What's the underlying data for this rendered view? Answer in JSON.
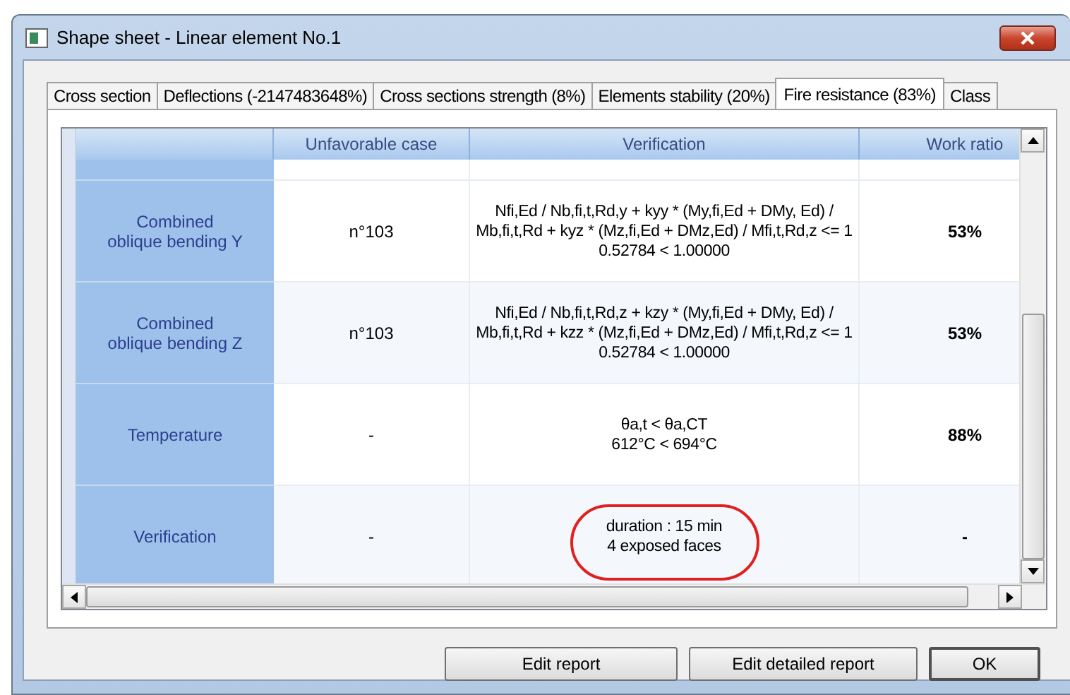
{
  "window": {
    "title": "Shape sheet - Linear element No.1"
  },
  "tabs": [
    {
      "label": "Cross section",
      "selected": false
    },
    {
      "label": "Deflections (-2147483648%)",
      "selected": false
    },
    {
      "label": "Cross sections strength (8%)",
      "selected": false
    },
    {
      "label": "Elements stability (20%)",
      "selected": false
    },
    {
      "label": "Fire resistance (83%)",
      "selected": true
    },
    {
      "label": "Class",
      "selected": false
    }
  ],
  "table": {
    "columns": [
      "Unfavorable case",
      "Verification",
      "Work ratio"
    ],
    "rows": [
      {
        "label": "Combined\noblique bending Y",
        "case": "n°103",
        "verification": "Nfi,Ed / Nb,fi,t,Rd,y + kyy * (My,fi,Ed + DMy, Ed) /\nMb,fi,t,Rd + kyz * (Mz,fi,Ed + DMz,Ed) / Mfi,t,Rd,z <= 1\n0.52784 < 1.00000",
        "ratio": "53%",
        "highlighted": false
      },
      {
        "label": "Combined\noblique bending Z",
        "case": "n°103",
        "verification": "Nfi,Ed / Nb,fi,t,Rd,z + kzy * (My,fi,Ed + DMy, Ed) /\nMb,fi,t,Rd + kzz * (Mz,fi,Ed + DMz,Ed) / Mfi,t,Rd,z <= 1\n0.52784 < 1.00000",
        "ratio": "53%",
        "highlighted": false
      },
      {
        "label": "Temperature",
        "case": "-",
        "verification": "θa,t < θa,CT\n612°C < 694°C",
        "ratio": "88%",
        "highlighted": false
      },
      {
        "label": "Verification",
        "case": "-",
        "verification": "duration : 15 min\n4 exposed faces",
        "ratio": "-",
        "highlighted": true
      }
    ]
  },
  "buttons": [
    "Edit report",
    "Edit detailed report",
    "OK"
  ]
}
